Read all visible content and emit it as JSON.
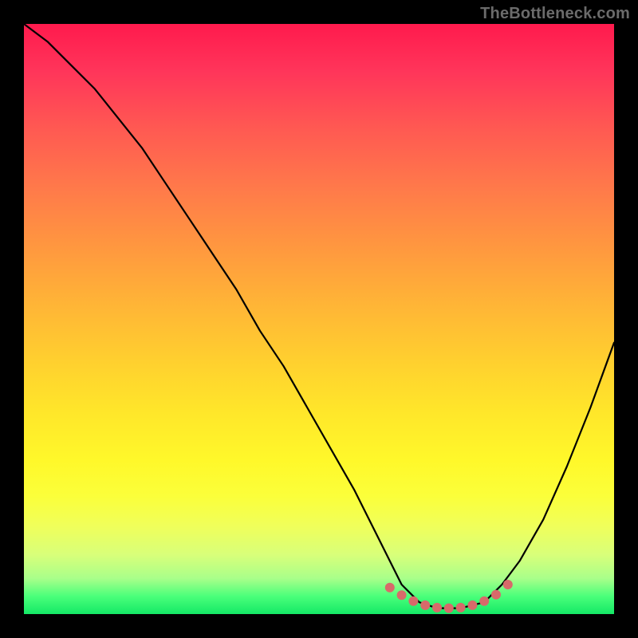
{
  "watermark": "TheBottleneck.com",
  "chart_data": {
    "type": "line",
    "title": "",
    "xlabel": "",
    "ylabel": "",
    "xlim": [
      0,
      100
    ],
    "ylim": [
      0,
      100
    ],
    "grid": false,
    "legend": false,
    "series": [
      {
        "name": "bottleneck-curve",
        "color": "#000000",
        "x": [
          0,
          4,
          8,
          12,
          16,
          20,
          24,
          28,
          32,
          36,
          40,
          44,
          48,
          52,
          56,
          60,
          62,
          64,
          67,
          70,
          74,
          78,
          81,
          84,
          88,
          92,
          96,
          100
        ],
        "y": [
          100,
          97,
          93,
          89,
          84,
          79,
          73,
          67,
          61,
          55,
          48,
          42,
          35,
          28,
          21,
          13,
          9,
          5,
          2,
          1,
          1,
          2,
          5,
          9,
          16,
          25,
          35,
          46
        ]
      },
      {
        "name": "optimal-range-marker",
        "color": "#d86a6a",
        "style": "dotted-thick",
        "x": [
          62,
          64,
          66,
          68,
          70,
          72,
          74,
          76,
          78,
          80,
          82
        ],
        "y": [
          4.5,
          3.2,
          2.2,
          1.5,
          1.1,
          1.0,
          1.1,
          1.5,
          2.2,
          3.3,
          5.0
        ]
      }
    ]
  }
}
